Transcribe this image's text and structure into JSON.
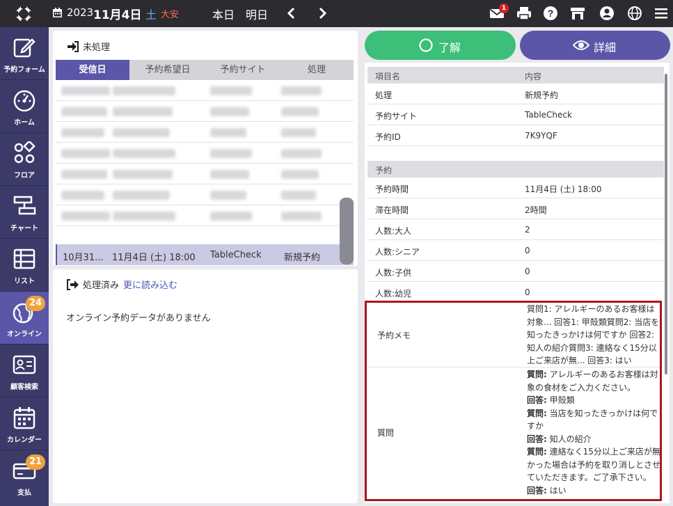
{
  "topbar": {
    "year": "2023",
    "month_day": "11月4日",
    "weekday": "土",
    "rokuyo": "大安",
    "today": "本日",
    "tomorrow": "明日",
    "mail_badge": "1",
    "icons": [
      "logo-icon",
      "calendar-icon",
      "chevron-left-icon",
      "chevron-right-icon",
      "mail-icon",
      "print-icon",
      "help-icon",
      "store-icon",
      "user-icon",
      "globe-icon",
      "menu-icon"
    ]
  },
  "sidebar": {
    "items": [
      {
        "label": "予約フォーム",
        "icon": "edit-icon"
      },
      {
        "label": "ホーム",
        "icon": "gauge-icon"
      },
      {
        "label": "フロア",
        "icon": "floor-icon"
      },
      {
        "label": "チャート",
        "icon": "chart-icon"
      },
      {
        "label": "リスト",
        "icon": "list-icon"
      },
      {
        "label": "オンライン",
        "icon": "online-icon",
        "badge": "24"
      },
      {
        "label": "顧客検索",
        "icon": "customer-icon"
      },
      {
        "label": "カレンダー",
        "icon": "calendar-icon"
      },
      {
        "label": "支払",
        "icon": "payment-icon",
        "badge": "21"
      }
    ]
  },
  "unprocessed": {
    "title": "未処理",
    "columns": [
      "受信日",
      "予約希望日",
      "予約サイト",
      "処理"
    ],
    "selected_row": {
      "received": "10月31...",
      "desired": "11月4日 (土) 18:00",
      "site": "TableCheck",
      "status": "新規予約"
    }
  },
  "processed": {
    "title": "処理済み",
    "read_more": "更に読み込む",
    "empty": "オンライン予約データがありません"
  },
  "buttons": {
    "ok": "了解",
    "detail": "詳細"
  },
  "detail": {
    "header": {
      "key": "項目名",
      "value": "内容"
    },
    "rows": [
      {
        "key": "処理",
        "value": "新規予約"
      },
      {
        "key": "予約サイト",
        "value": "TableCheck"
      },
      {
        "key": "予約ID",
        "value": "7K9YQF"
      }
    ],
    "reservation_header": "予約",
    "reservation_rows": [
      {
        "key": "予約時間",
        "value": "11月4日 (土) 18:00"
      },
      {
        "key": "滞在時間",
        "value": "2時間"
      },
      {
        "key": "人数:大人",
        "value": "2"
      },
      {
        "key": "人数:シニア",
        "value": "0"
      },
      {
        "key": "人数:子供",
        "value": "0"
      },
      {
        "key": "人数:幼児",
        "value": "0"
      }
    ],
    "memo_key": "予約メモ",
    "memo_value": "質問1: アレルギーのあるお客様は対象... 回答1: 甲殻類質問2: 当店を知ったきっかけは何ですか 回答2: 知人の紹介質問3: 連絡なく15分以上ご来店が無... 回答3: はい",
    "question_key": "質問",
    "qa": [
      {
        "q_label": "質問:",
        "q": " アレルギーのあるお客様は対象の食材をご入力ください。",
        "a_label": "回答:",
        "a": " 甲殻類"
      },
      {
        "q_label": "質問:",
        "q": " 当店を知ったきっかけは何ですか",
        "a_label": "回答:",
        "a": " 知人の紹介"
      },
      {
        "q_label": "質問:",
        "q": " 連絡なく15分以上ご来店が無かった場合は予約を取り消しとさせていただきます。ご了承下さい。",
        "a_label": "回答:",
        "a": " はい"
      }
    ]
  }
}
